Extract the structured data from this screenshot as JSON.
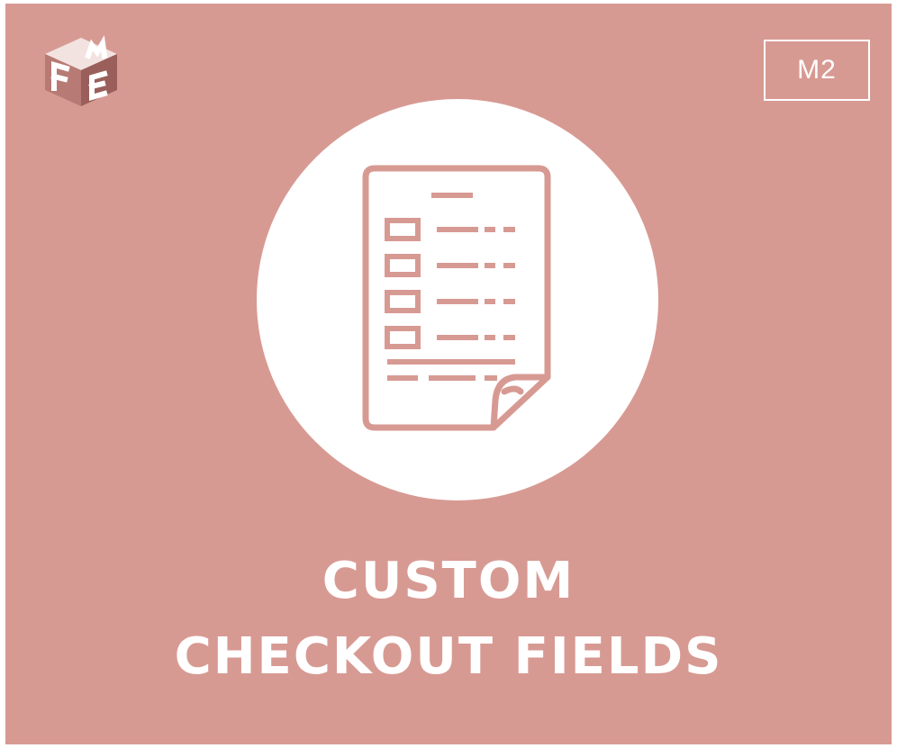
{
  "brand": {
    "logo_letters": [
      "F",
      "M",
      "E"
    ],
    "logo_icon": "cube-logo-icon"
  },
  "badge": {
    "label": "M2"
  },
  "hero": {
    "icon": "checkout-form-document-icon"
  },
  "title": {
    "line1": "CUSTOM",
    "line2": "CHECKOUT FIELDS"
  },
  "colors": {
    "background": "#d79a93",
    "foreground": "#ffffff",
    "logo_dark": "#9a5f5a"
  }
}
